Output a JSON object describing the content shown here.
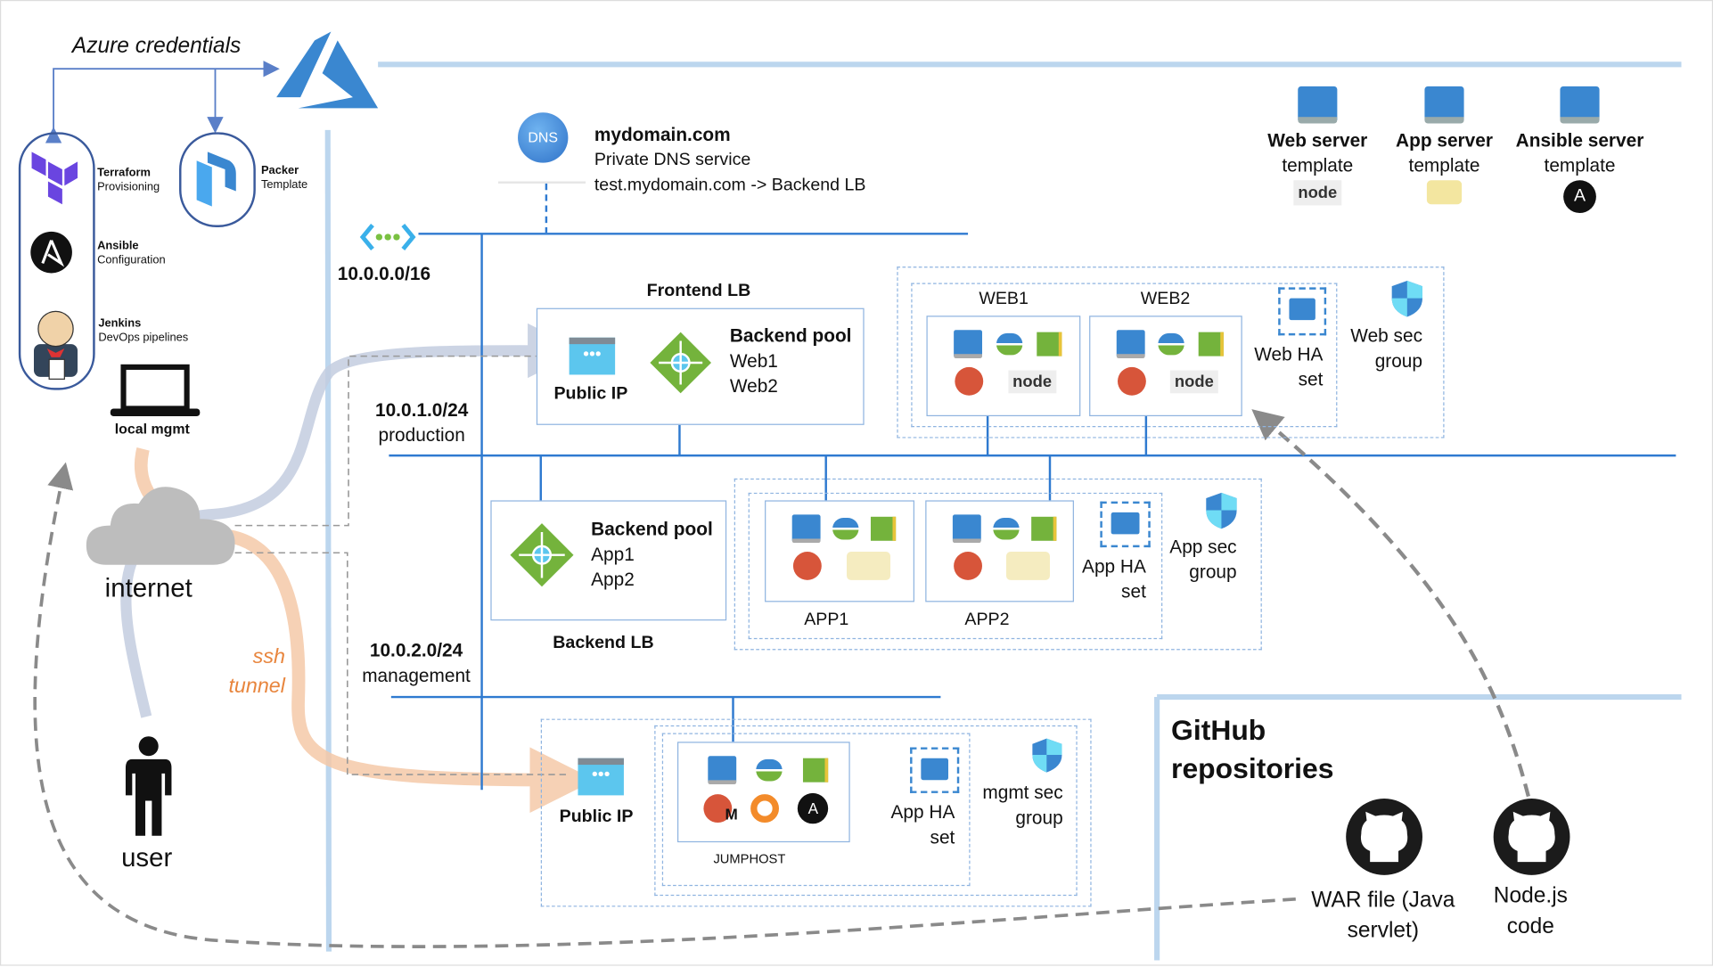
{
  "azure_credentials": "Azure credentials",
  "tools": [
    {
      "name": "Terraform",
      "desc": "Provisioning"
    },
    {
      "name": "Packer",
      "desc": "Template"
    },
    {
      "name": "Ansible",
      "desc": "Configuration"
    },
    {
      "name": "Jenkins",
      "desc": "DevOps pipelines"
    }
  ],
  "local_mgmt": "local mgmt",
  "internet": "internet",
  "user": "user",
  "ssh_tunnel": [
    "ssh",
    "tunnel"
  ],
  "dns": {
    "icon": "DNS",
    "domain": "mydomain.com",
    "service": "Private DNS service",
    "record": "test.mydomain.com -> Backend LB"
  },
  "vnet": "10.0.0.0/16",
  "subnets": {
    "production": {
      "cidr": "10.0.1.0/24",
      "name": "production"
    },
    "management": {
      "cidr": "10.0.2.0/24",
      "name": "management"
    }
  },
  "frontend_lb": {
    "title": "Frontend LB",
    "public_ip": "Public IP",
    "pool": [
      "Backend pool",
      "Web1",
      "Web2"
    ]
  },
  "backend_lb": {
    "title": "Backend LB",
    "pool": [
      "Backend pool",
      "App1",
      "App2"
    ]
  },
  "web": {
    "vms": [
      "WEB1",
      "WEB2"
    ],
    "ha": [
      "Web HA",
      "set"
    ],
    "sec": [
      "Web sec",
      "group"
    ]
  },
  "app": {
    "vms": [
      "APP1",
      "APP2"
    ],
    "ha": [
      "App HA",
      "set"
    ],
    "sec": [
      "App sec",
      "group"
    ]
  },
  "mgmt": {
    "public_ip": "Public IP",
    "vm": "JUMPHOST",
    "ha": [
      "App HA",
      "set"
    ],
    "sec": [
      "mgmt sec",
      "group"
    ],
    "m_badge": "M"
  },
  "templates": [
    {
      "bold": "Web server",
      "rest": "template",
      "logo": "node"
    },
    {
      "bold": "App server",
      "rest": "template",
      "logo": "tomcat"
    },
    {
      "bold": "Ansible server",
      "rest": "template",
      "logo": "ansible"
    }
  ],
  "github": {
    "title": [
      "GitHub",
      "repositories"
    ],
    "repos": [
      [
        "WAR file (Java",
        "servlet)"
      ],
      [
        "Node.js",
        "code"
      ]
    ]
  },
  "colors": {
    "azure": "#3a87d0",
    "line": "#2f7ad0",
    "light_line": "#bcd6ee",
    "ssh": "#f5c9a8",
    "user_path": "#b7c4da",
    "dashed_gray": "#8a8a8a",
    "terraform": "#6a45e0",
    "prometheus": "#d7553a"
  }
}
